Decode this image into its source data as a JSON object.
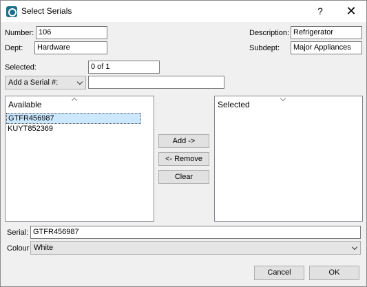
{
  "window": {
    "title": "Select Serials",
    "help_symbol": "?",
    "close_symbol": "✕"
  },
  "form": {
    "number_label": "Number:",
    "number_value": "106",
    "description_label": "Description:",
    "description_value": "Refrigerator",
    "dept_label": "Dept:",
    "dept_value": "Hardware",
    "subdept_label": "Subdept:",
    "subdept_value": "Major Appliances",
    "selected_label": "Selected:",
    "selected_value": "0 of 1",
    "add_serial_combo": "Add a Serial #:",
    "add_serial_value": ""
  },
  "available": {
    "header": "Available",
    "items": [
      {
        "label": "GTFR456987",
        "selected": true
      },
      {
        "label": "KUYT852369",
        "selected": false
      }
    ]
  },
  "selected_list": {
    "header": "Selected",
    "items": []
  },
  "actions": {
    "add_label": "Add ->",
    "remove_label": "<- Remove",
    "clear_label": "Clear"
  },
  "details": {
    "serial_label": "Serial:",
    "serial_value": "GTFR456987",
    "colour_label": "Colour",
    "colour_value": "White"
  },
  "footer": {
    "cancel_label": "Cancel",
    "ok_label": "OK"
  }
}
